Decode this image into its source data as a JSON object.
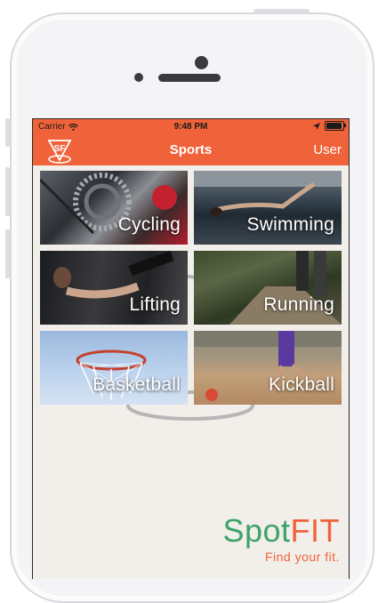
{
  "status_bar": {
    "carrier": "Carrier",
    "time": "9:48 PM",
    "battery_level": 1.0
  },
  "nav_bar": {
    "title": "Sports",
    "right_button": "User",
    "logo_text": "SF"
  },
  "sports": [
    {
      "label": "Cycling"
    },
    {
      "label": "Swimming"
    },
    {
      "label": "Lifting"
    },
    {
      "label": "Running"
    },
    {
      "label": "Basketball"
    },
    {
      "label": "Kickball"
    }
  ],
  "branding": {
    "name_part1": "Spot",
    "name_part2": "FIT",
    "tagline": "Find your fit."
  },
  "colors": {
    "accent": "#f0633a",
    "brand_green": "#3da36a",
    "background": "#f2eee9"
  }
}
